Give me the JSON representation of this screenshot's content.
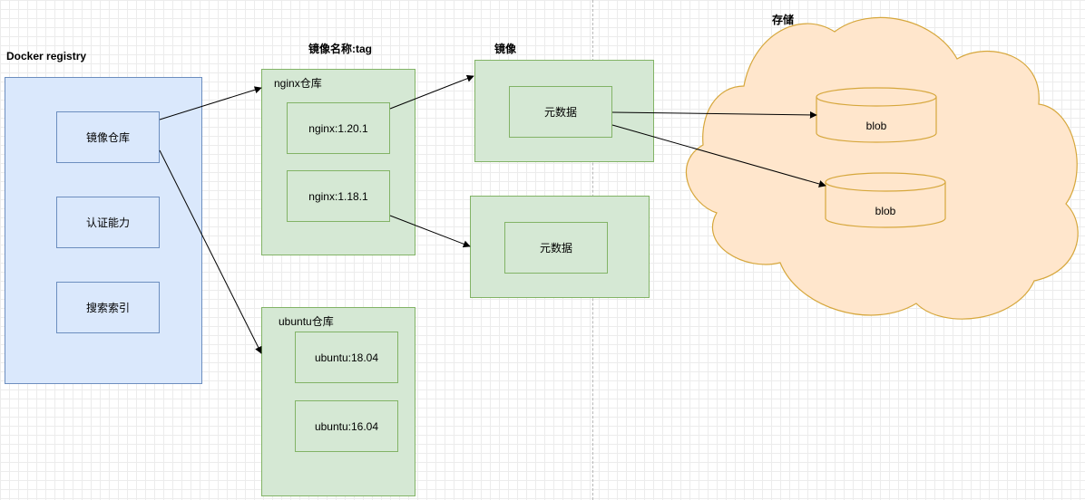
{
  "headings": {
    "registry": "Docker registry",
    "repo_tag": "镜像名称:tag",
    "image": "镜像",
    "storage": "存储"
  },
  "registry": {
    "items": [
      "镜像仓库",
      "认证能力",
      "搜索索引"
    ]
  },
  "repos": {
    "nginx": {
      "label": "nginx仓库",
      "tags": [
        "nginx:1.20.1",
        "nginx:1.18.1"
      ]
    },
    "ubuntu": {
      "label": "ubuntu仓库",
      "tags": [
        "ubuntu:18.04",
        "ubuntu:16.04"
      ]
    }
  },
  "images": {
    "first": {
      "metadata": "元数据"
    },
    "second": {
      "metadata": "元数据"
    }
  },
  "storage": {
    "blobs": [
      "blob",
      "blob"
    ]
  },
  "colors": {
    "green_fill": "#d5e8d4",
    "green_stroke": "#82b366",
    "blue_fill": "#dae8fc",
    "blue_stroke": "#6c8ebf",
    "cloud_fill": "#ffe6cc",
    "cloud_stroke": "#d6a73c"
  }
}
